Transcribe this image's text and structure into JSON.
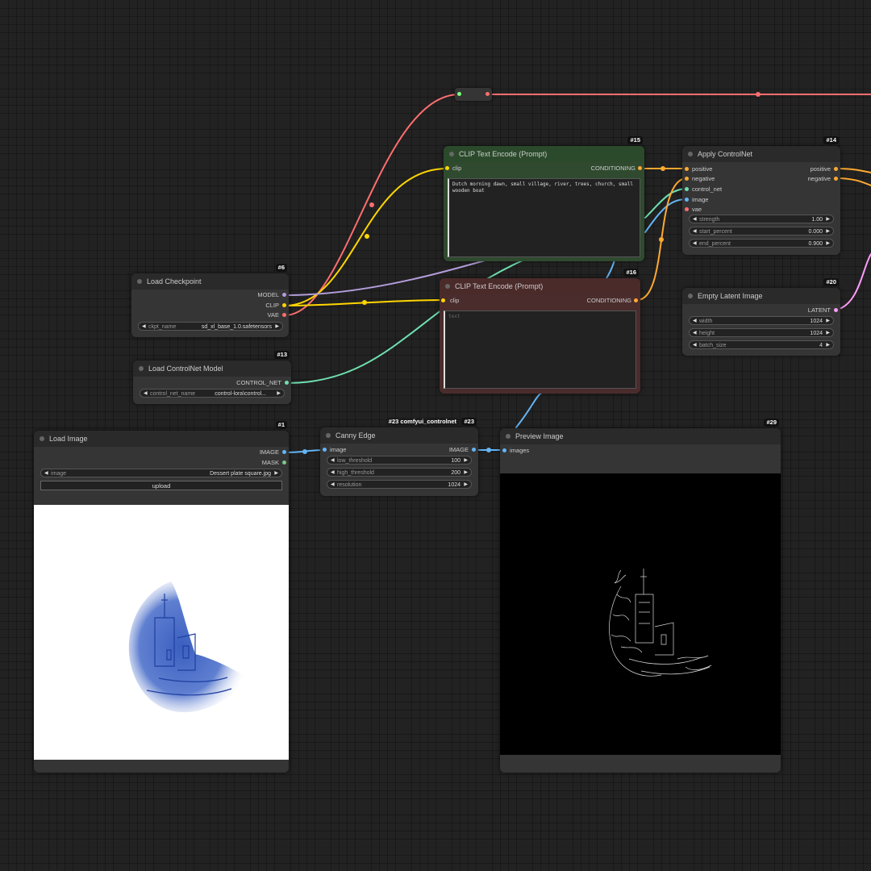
{
  "colors": {
    "background": "#222222",
    "node_body": "#353535",
    "clip_pos_body": "#2f4a2f",
    "clip_pos_header": "#2b4a2b",
    "clip_neg_body": "#4a2c2c",
    "clip_neg_header": "#4b2a2a",
    "MODEL": "#b39ddb",
    "CLIP": "#ffd500",
    "VAE": "#ff6e6e",
    "CONDITIONING": "#ffa931",
    "CONTROL_NET": "#6fe0b0",
    "IMAGE": "#64b5f6",
    "MASK": "#81c784",
    "LATENT": "#ff9cf9"
  },
  "nodes": {
    "clip_pos": {
      "id": "#15",
      "title": "CLIP Text Encode (Prompt)",
      "in_clip": "clip",
      "out_cond": "CONDITIONING",
      "text": "Dutch morning dawn, small village, river, trees, church, small wooden boat"
    },
    "clip_neg": {
      "id": "#16",
      "title": "CLIP Text Encode (Prompt)",
      "in_clip": "clip",
      "out_cond": "CONDITIONING",
      "placeholder": "text"
    },
    "apply_cn": {
      "id": "#14",
      "title": "Apply ControlNet",
      "inputs": [
        "positive",
        "negative",
        "control_net",
        "image",
        "vae"
      ],
      "outputs": [
        "positive",
        "negative"
      ],
      "widgets": [
        {
          "label": "strength",
          "value": "1.00"
        },
        {
          "label": "start_percent",
          "value": "0.000"
        },
        {
          "label": "end_percent",
          "value": "0.900"
        }
      ]
    },
    "empty_latent": {
      "id": "#20",
      "title": "Empty Latent Image",
      "output": "LATENT",
      "widgets": [
        {
          "label": "width",
          "value": "1024"
        },
        {
          "label": "height",
          "value": "1024"
        },
        {
          "label": "batch_size",
          "value": "4"
        }
      ]
    },
    "load_checkpoint": {
      "id": "#6",
      "title": "Load Checkpoint",
      "outputs": [
        "MODEL",
        "CLIP",
        "VAE"
      ],
      "widget": {
        "label": "ckpt_name",
        "value": "sd_xl_base_1.0.safetensors"
      }
    },
    "load_cn": {
      "id": "#13",
      "title": "Load ControlNet Model",
      "output": "CONTROL_NET",
      "widget": {
        "label": "control_net_name",
        "value": "control-lora\\control..."
      }
    },
    "load_image": {
      "id": "#1",
      "title": "Load Image",
      "outputs": [
        "IMAGE",
        "MASK"
      ],
      "widget": {
        "label": "image",
        "value": "Dessert plate square.jpg"
      },
      "upload_label": "upload"
    },
    "canny": {
      "id": "#23",
      "group_label": "#23 comfyui_controlnet",
      "title": "Canny Edge",
      "input": "image",
      "output": "IMAGE",
      "widgets": [
        {
          "label": "low_threshold",
          "value": "100"
        },
        {
          "label": "high_threshold",
          "value": "200"
        },
        {
          "label": "resolution",
          "value": "1024"
        }
      ]
    },
    "preview": {
      "id": "#29",
      "title": "Preview Image",
      "input": "images"
    }
  }
}
